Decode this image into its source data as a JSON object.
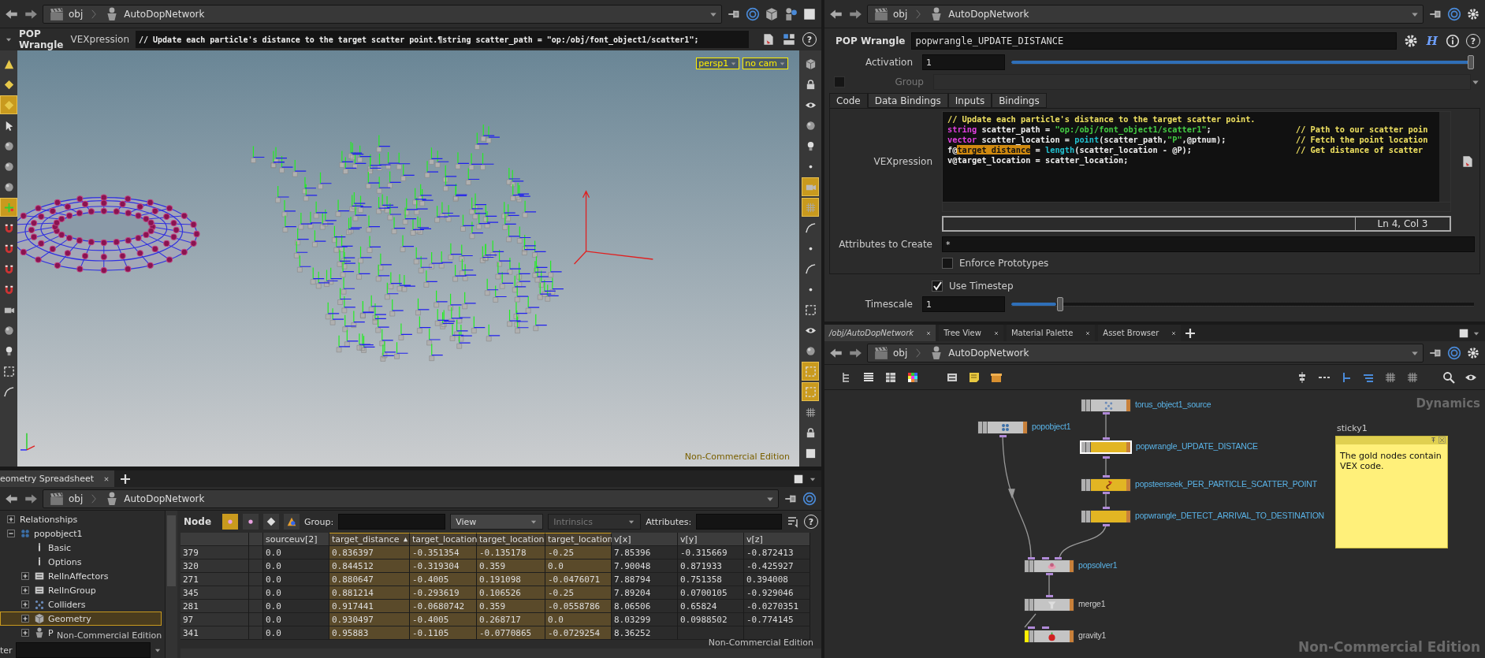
{
  "viewer_pane": {
    "nav": {
      "path": [
        "obj",
        "AutoDopNetwork"
      ]
    },
    "parameter_strip": {
      "node_type": "POP Wrangle",
      "parameter_label": "VEXpression",
      "value": "// Update each particle's distance to the target scatter point.¶string scatter_path = \"op:/obj/font_object1/scatter1\";",
      "help": "?"
    },
    "viewport": {
      "view_menu": "persp1",
      "camera_menu": "no cam",
      "edition_label": "Non-Commercial Edition",
      "left_toolbar": [
        {
          "selected": false
        },
        {
          "selected": false
        },
        {
          "selected": true
        },
        {
          "selected": false
        },
        {
          "selected": false
        },
        {
          "selected": false
        },
        {
          "selected": false
        },
        {
          "selected": true
        },
        {
          "selected": false
        },
        {
          "selected": false
        },
        {
          "selected": false
        },
        {
          "selected": false
        },
        {
          "selected": false
        },
        {
          "selected": false
        },
        {
          "selected": false
        },
        {
          "selected": false
        },
        {
          "selected": false
        }
      ],
      "right_toolbar": [
        {
          "selected": false
        },
        {
          "selected": false
        },
        {
          "selected": false
        },
        {
          "selected": false
        },
        {
          "selected": false
        },
        {
          "selected": false
        },
        {
          "selected": true
        },
        {
          "selected": true
        },
        {
          "selected": false
        },
        {
          "selected": false
        },
        {
          "selected": false
        },
        {
          "selected": false
        },
        {
          "selected": false
        },
        {
          "selected": false
        },
        {
          "selected": false
        },
        {
          "selected": true
        },
        {
          "selected": true
        },
        {
          "selected": false
        },
        {
          "selected": false
        },
        {
          "selected": false
        }
      ]
    }
  },
  "spreadsheet_pane": {
    "tabs": [
      {
        "label": "eometry Spreadsheet",
        "selected": true
      }
    ],
    "nav": {
      "path": [
        "obj",
        "AutoDopNetwork"
      ]
    },
    "tree": [
      {
        "label": "Relationships",
        "expanded": false,
        "selected": false
      },
      {
        "label": "popobject1",
        "expanded": true,
        "selected": false,
        "children": [
          {
            "label": "Basic",
            "selected": false
          },
          {
            "label": "Options",
            "selected": false
          },
          {
            "label": "RelInAffectors",
            "expanded": false,
            "selected": false
          },
          {
            "label": "RelInGroup",
            "expanded": false,
            "selected": false
          },
          {
            "label": "Colliders",
            "expanded": false,
            "selected": false
          },
          {
            "label": "Geometry",
            "expanded": false,
            "selected": true
          },
          {
            "label": "P",
            "expanded": false,
            "selected": false
          }
        ]
      }
    ],
    "tree_overlay": "Non-Commercial Edition",
    "filter_label": "ter",
    "toolbar": {
      "mode_label": "Node",
      "filters": [
        {
          "selected": true
        },
        {
          "selected": false
        },
        {
          "selected": false
        },
        {
          "selected": false
        }
      ],
      "group_label": "Group:",
      "view_menu": "View",
      "intrinsics_menu": {
        "label": "Intrinsics",
        "disabled": true
      },
      "attributes_label": "Attributes:",
      "help": "?"
    },
    "table": {
      "columns": [
        {
          "label": "sourceuv[2]",
          "highlighted": false,
          "sorted": false
        },
        {
          "label": "target_distance",
          "highlighted": true,
          "sorted": true
        },
        {
          "label": "target_location",
          "highlighted": true,
          "sorted": false
        },
        {
          "label": "target_location",
          "highlighted": true,
          "sorted": false
        },
        {
          "label": "target_location",
          "highlighted": true,
          "sorted": false
        },
        {
          "label": "v[x]",
          "highlighted": false,
          "sorted": false
        },
        {
          "label": "v[y]",
          "highlighted": false,
          "sorted": false
        },
        {
          "label": "v[z]",
          "highlighted": false,
          "sorted": false
        }
      ],
      "rows": [
        {
          "index": "379",
          "cells": [
            "0.0",
            "0.836397",
            "-0.351354",
            "-0.135178",
            "-0.25",
            "7.85396",
            "-0.315669",
            "-0.872413"
          ]
        },
        {
          "index": "320",
          "cells": [
            "0.0",
            "0.844512",
            "-0.319304",
            "0.359",
            "0.0",
            "7.90048",
            "0.871933",
            "-0.425927"
          ]
        },
        {
          "index": "271",
          "cells": [
            "0.0",
            "0.880647",
            "-0.4005",
            "0.191098",
            "-0.0476071",
            "7.88794",
            "0.751358",
            "0.394008"
          ]
        },
        {
          "index": "345",
          "cells": [
            "0.0",
            "0.881214",
            "-0.293619",
            "0.106526",
            "-0.25",
            "7.89204",
            "0.0700105",
            "-0.929046"
          ]
        },
        {
          "index": "281",
          "cells": [
            "0.0",
            "0.917441",
            "-0.0680742",
            "0.359",
            "-0.0558786",
            "8.06506",
            "0.65824",
            "-0.0270351"
          ]
        },
        {
          "index": "97",
          "cells": [
            "0.0",
            "0.930497",
            "-0.4005",
            "0.268717",
            "0.0",
            "8.03299",
            "0.0988502",
            "-0.774145"
          ]
        },
        {
          "index": "341",
          "cells": [
            "0.0",
            "0.95883",
            "-0.1105",
            "-0.0770865",
            "-0.0729254",
            "8.36252"
          ]
        }
      ]
    },
    "edition_label": "Non-Commercial Edition"
  },
  "parameter_pane": {
    "nav": {
      "path": [
        "obj",
        "AutoDopNetwork"
      ]
    },
    "node_type": "POP Wrangle",
    "node_name": "popwrangle_UPDATE_DISTANCE",
    "hda_button": "H",
    "help": "?",
    "activation": {
      "label": "Activation",
      "value": "1",
      "level": 1
    },
    "group": {
      "label": "Group",
      "checked": false,
      "disabled": true
    },
    "tabs": [
      {
        "label": "Code",
        "selected": true
      },
      {
        "label": "Data Bindings",
        "selected": false
      },
      {
        "label": "Inputs",
        "selected": false
      },
      {
        "label": "Bindings",
        "selected": false
      }
    ],
    "vexpression": {
      "label": "VEXpression",
      "lines": [
        {
          "code": [
            {
              "kind": "comment",
              "text": "// Update each particle's distance to the target scatter point."
            }
          ]
        },
        {
          "code": [
            {
              "kind": "keyword",
              "text": "string"
            },
            {
              "kind": "plain",
              "text": " scatter_path = "
            },
            {
              "kind": "string",
              "text": "\"op:/obj/font_object1/scatter1\""
            },
            {
              "kind": "plain",
              "text": ";"
            }
          ],
          "comment": "// Path to our scatter poin"
        },
        {
          "code": [
            {
              "kind": "keyword",
              "text": "vector"
            },
            {
              "kind": "plain",
              "text": " scatter_location = "
            },
            {
              "kind": "function",
              "text": "point"
            },
            {
              "kind": "plain",
              "text": "(scatter_path,"
            },
            {
              "kind": "string",
              "text": "\"P\""
            },
            {
              "kind": "plain",
              "text": ",@ptnum);"
            }
          ],
          "comment": "// Fetch the point location"
        },
        {
          "code": [
            {
              "kind": "plain",
              "text": "f@"
            },
            {
              "kind": "highlight",
              "text": "target_distance"
            },
            {
              "kind": "plain",
              "text": " = "
            },
            {
              "kind": "function",
              "text": "length"
            },
            {
              "kind": "plain",
              "text": "(scatter_location - @P);"
            }
          ],
          "comment": "// Get distance of scatter"
        },
        {
          "code": [
            {
              "kind": "plain",
              "text": "v@target_location = scatter_location;"
            }
          ]
        }
      ]
    },
    "cursor_position": "Ln 4, Col 3",
    "attributes_to_create": {
      "label": "Attributes to Create",
      "value": "*"
    },
    "enforce_prototypes": {
      "label": "Enforce Prototypes",
      "checked": false
    },
    "use_timestep": {
      "label": "Use Timestep",
      "checked": true
    },
    "timescale": {
      "label": "Timescale",
      "value": "1",
      "level": 0.1
    }
  },
  "network_pane": {
    "tabs": [
      {
        "label": "/obj/AutoDopNetwork",
        "selected": true
      },
      {
        "label": "Tree View",
        "selected": false
      },
      {
        "label": "Material Palette",
        "selected": false
      },
      {
        "label": "Asset Browser",
        "selected": false
      }
    ],
    "nav": {
      "path": [
        "obj",
        "AutoDopNetwork"
      ]
    },
    "context_label": "Dynamics",
    "nodes": [
      {
        "name": "torus_object1_source",
        "color": "#c4c4c4",
        "selected": false,
        "label_highlighted": true,
        "display_flag": false
      },
      {
        "name": "popobject1",
        "color": "#c4c4c4",
        "selected": false,
        "label_highlighted": true,
        "display_flag": false
      },
      {
        "name": "popwrangle_UPDATE_DISTANCE",
        "color": "#e2b523",
        "selected": true,
        "label_highlighted": true,
        "display_flag": false
      },
      {
        "name": "popsteerseek_PER_PARTICLE_SCATTER_POINT",
        "color": "#e2b523",
        "selected": false,
        "label_highlighted": true,
        "display_flag": false
      },
      {
        "name": "popwrangle_DETECT_ARRIVAL_TO_DESTINATION",
        "color": "#e2b523",
        "selected": false,
        "label_highlighted": true,
        "display_flag": false
      },
      {
        "name": "popsolver1",
        "color": "#c4c4c4",
        "selected": false,
        "label_highlighted": true,
        "display_flag": false
      },
      {
        "name": "merge1",
        "color": "#c4c4c4",
        "selected": false,
        "label_highlighted": false,
        "display_flag": false
      },
      {
        "name": "gravity1",
        "color": "#c4c4c4",
        "selected": false,
        "label_highlighted": false,
        "display_flag": true
      }
    ],
    "sticky_note": {
      "title": "sticky1",
      "text": "The gold nodes contain VEX code."
    },
    "edition_label": "Non-Commercial Edition"
  }
}
